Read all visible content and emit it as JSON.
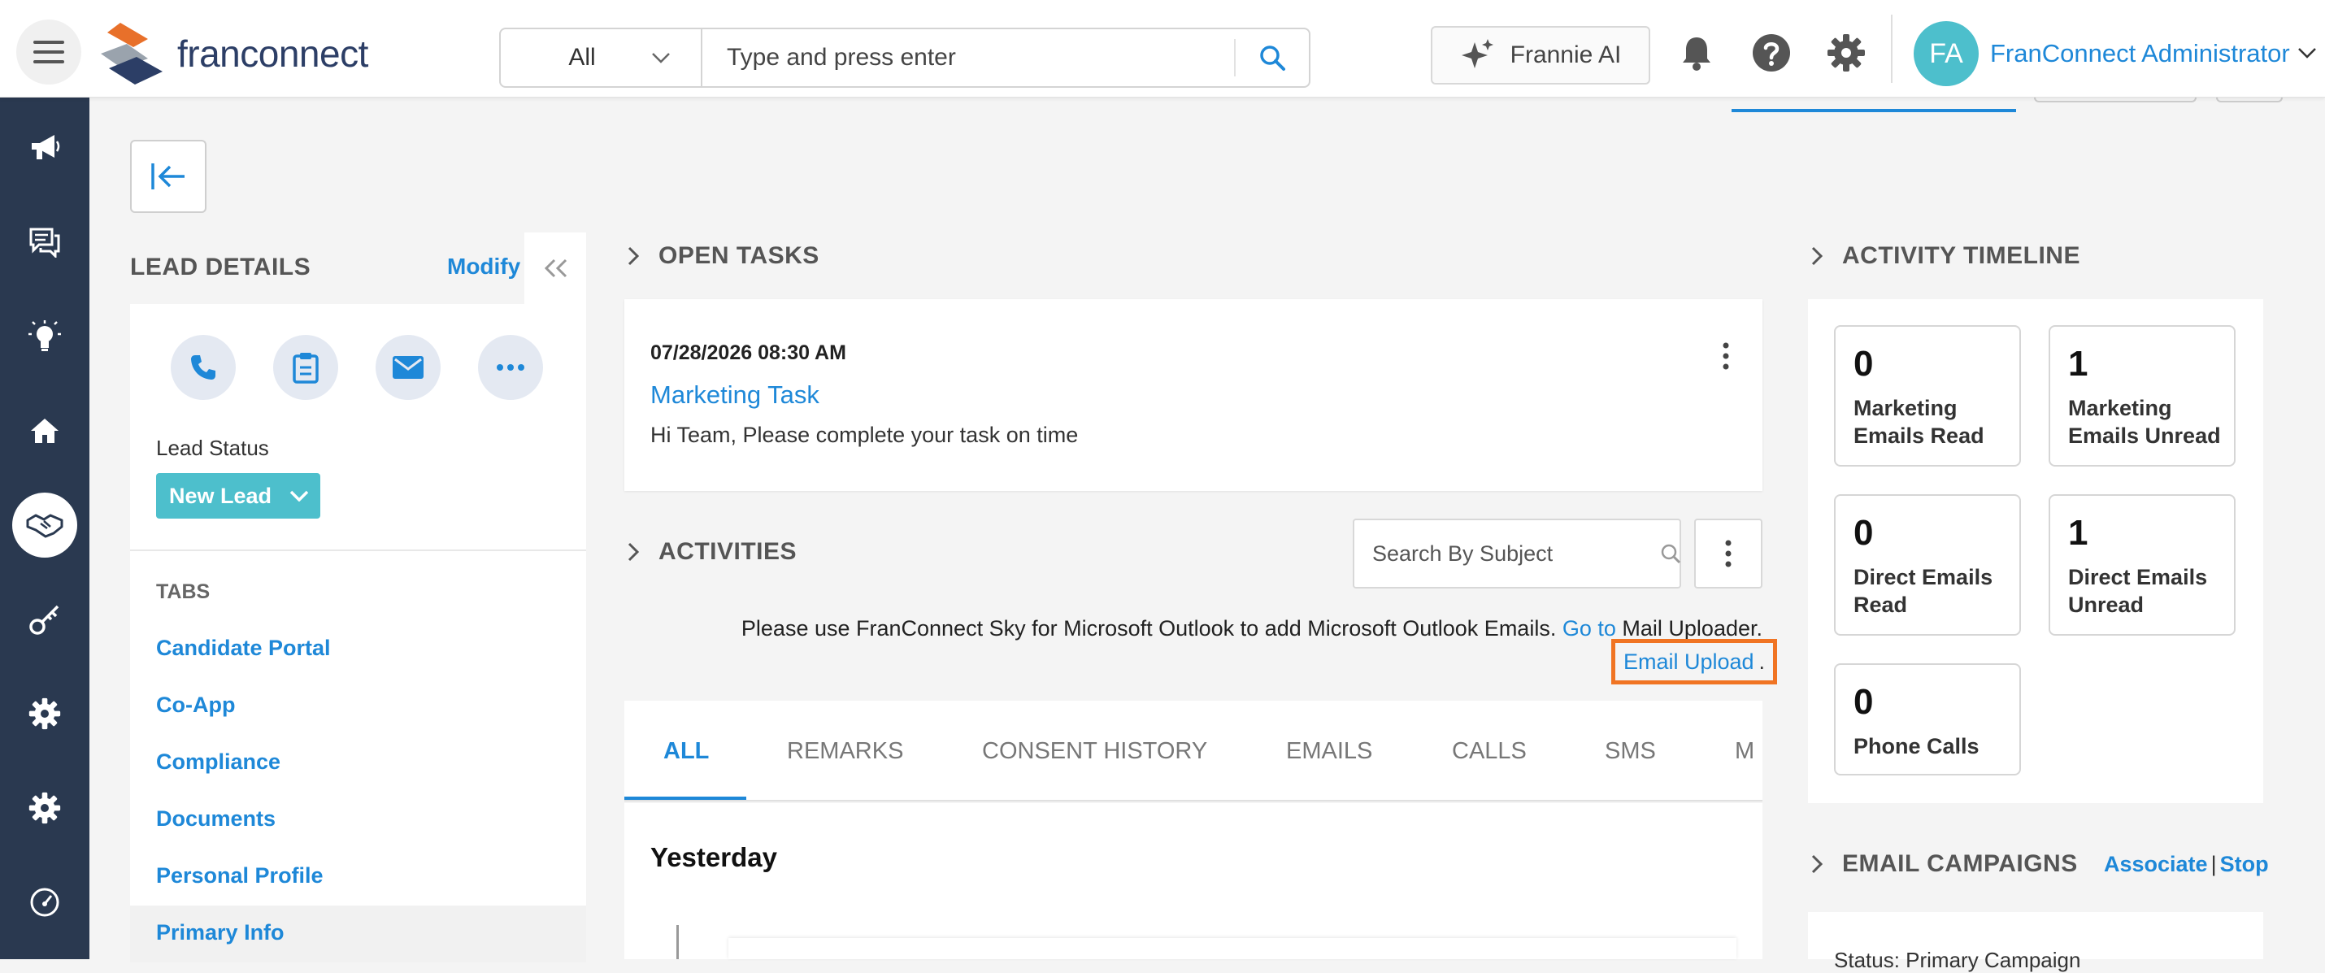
{
  "header": {
    "logo_text": "franconnect",
    "search_scope": "All",
    "search_placeholder": "Type and press enter",
    "frannie_label": "Frannie AI",
    "user_initials": "FA",
    "user_name": "FranConnect Administrator"
  },
  "sidebar_icons": [
    "megaphone-icon",
    "chat-icon",
    "lightbulb-icon",
    "home-icon",
    "handshake-icon",
    "key-icon",
    "gear-icon",
    "gear-icon",
    "dashboard-icon"
  ],
  "lead_details": {
    "title": "LEAD DETAILS",
    "modify_label": "Modify",
    "status_label": "Lead Status",
    "status_value": "New Lead",
    "tabs_heading": "TABS",
    "tabs": [
      "Candidate Portal",
      "Co-App",
      "Compliance",
      "Documents",
      "Personal Profile",
      "Primary Info"
    ]
  },
  "open_tasks": {
    "title": "OPEN TASKS",
    "task": {
      "datetime": "07/28/2026 08:30 AM",
      "name": "Marketing Task",
      "description": "Hi Team, Please complete your task on time"
    }
  },
  "activities": {
    "title": "ACTIVITIES",
    "search_placeholder": "Search By Subject",
    "notice_text": "Please use FranConnect Sky for Microsoft Outlook to add Microsoft Outlook Emails.",
    "goto_label": "Go to",
    "mail_uploader_label": "Mail Uploader.",
    "email_upload_label": "Email Upload",
    "email_upload_suffix": ".",
    "tabs": [
      "ALL",
      "REMARKS",
      "CONSENT HISTORY",
      "EMAILS",
      "CALLS",
      "SMS",
      "M"
    ],
    "active_tab": "ALL",
    "day_label": "Yesterday"
  },
  "activity_timeline": {
    "title": "ACTIVITY TIMELINE",
    "stats": [
      {
        "value": "0",
        "label": "Marketing Emails Read"
      },
      {
        "value": "1",
        "label": "Marketing Emails Unread"
      },
      {
        "value": "0",
        "label": "Direct Emails Read"
      },
      {
        "value": "1",
        "label": "Direct Emails Unread"
      },
      {
        "value": "0",
        "label": "Phone Calls"
      }
    ]
  },
  "email_campaigns": {
    "title": "EMAIL CAMPAIGNS",
    "associate_label": "Associate",
    "separator": "|",
    "stop_label": "Stop",
    "peek_text": "Status: Primary Campaign"
  },
  "colors": {
    "accent": "#1e88d8",
    "sidebar": "#2a3950",
    "status": "#4dbfcc",
    "highlight": "#f07423"
  }
}
